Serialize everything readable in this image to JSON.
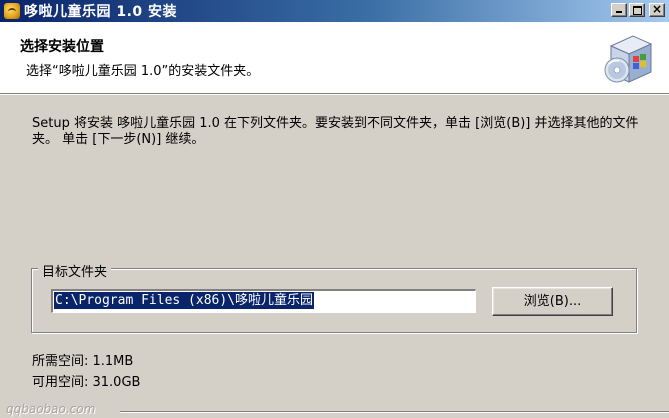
{
  "window": {
    "title": "哆啦儿童乐园 1.0 安装",
    "minimize_label": "_",
    "close_label": "×"
  },
  "header": {
    "title": "选择安装位置",
    "subtitle": "选择“哆啦儿童乐园 1.0”的安装文件夹。"
  },
  "body": {
    "description": "Setup 将安装 哆啦儿童乐园 1.0 在下列文件夹。要安装到不同文件夹，单击 [浏览(B)] 并选择其他的文件夹。 单击 [下一步(N)] 继续。"
  },
  "destination": {
    "group_label": "目标文件夹",
    "path_value": "C:\\Program Files (x86)\\哆啦儿童乐园",
    "browse_label": "浏览(B)..."
  },
  "space": {
    "required": "所需空间: 1.1MB",
    "available": "可用空间: 31.0GB"
  },
  "footer": {
    "brand": "qqbaobao.com"
  },
  "icons": {
    "title": "app-icon",
    "header": "installer-box-icon"
  }
}
